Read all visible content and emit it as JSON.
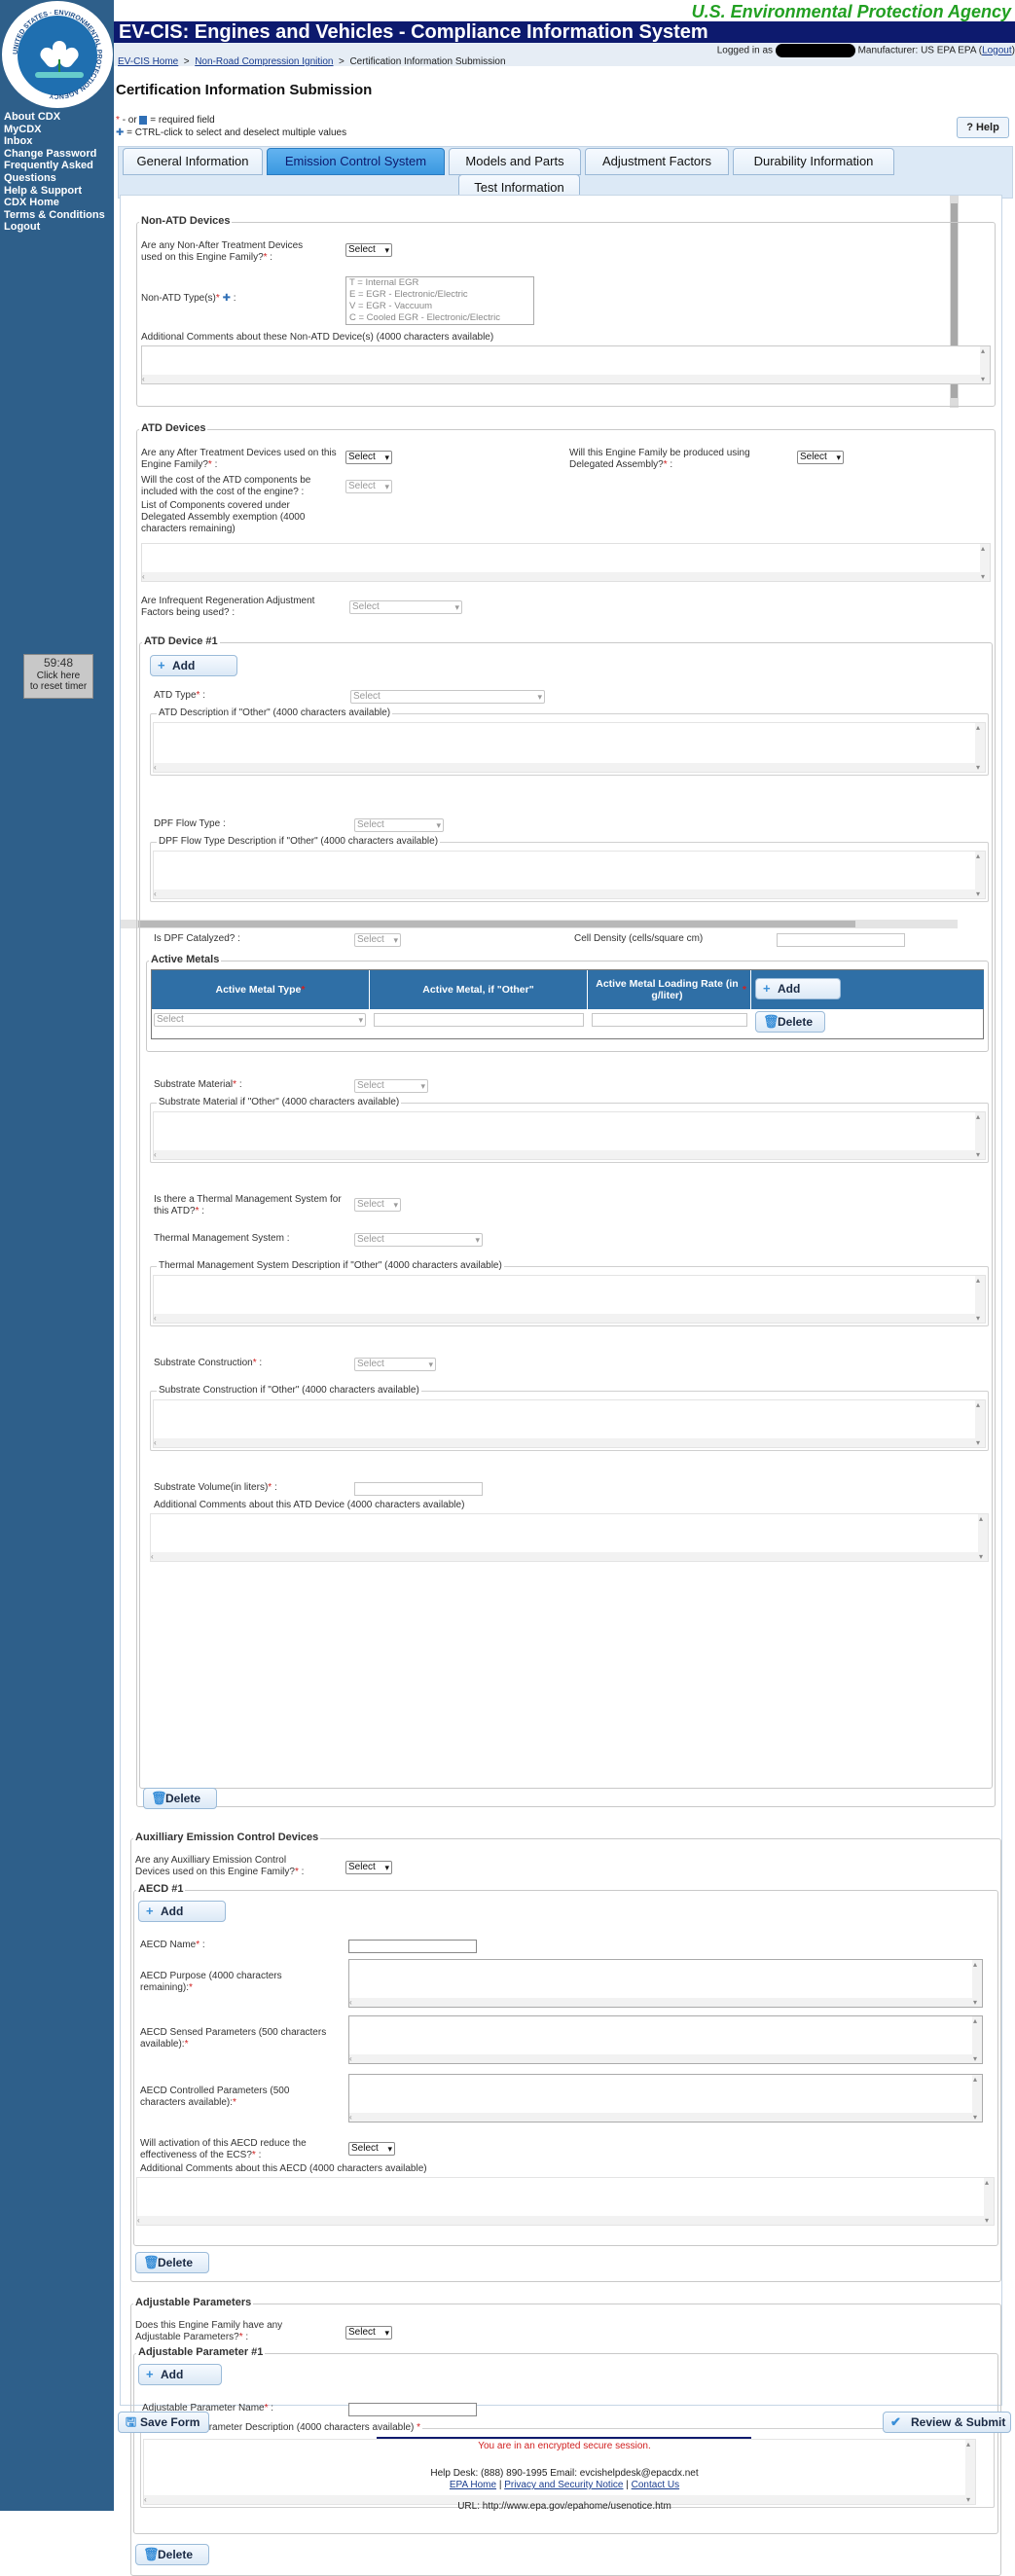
{
  "header": {
    "agency": "U.S. Environmental Protection Agency",
    "app_title": "EV-CIS: Engines and Vehicles - Compliance Information System",
    "breadcrumb": [
      "EV-CIS Home",
      "Non-Road Compression Ignition",
      "Certification Information Submission"
    ],
    "login_prefix": "Logged in as",
    "manufacturer": "Manufacturer: US EPA EPA",
    "logout": "Logout"
  },
  "sidebar": {
    "nav": [
      "About CDX",
      "MyCDX",
      "Inbox",
      "Change Password",
      "Frequently Asked Questions",
      "Help & Support",
      "CDX Home",
      "Terms & Conditions",
      "Logout"
    ],
    "timer": {
      "time": "59:48",
      "line1": "Click here",
      "line2": "to reset timer"
    }
  },
  "page": {
    "title": "Certification Information Submission",
    "legend_required": "= required field",
    "legend_required_prefix": "- or",
    "legend_multi": "= CTRL-click to select and deselect multiple values",
    "help": "? Help"
  },
  "tabs": [
    "General Information",
    "Emission Control System",
    "Models and Parts",
    "Adjustment Factors",
    "Durability Information",
    "Test Information"
  ],
  "active_tab": "Emission Control System",
  "non_atd": {
    "title": "Non-ATD Devices",
    "q_used": "Are any Non-After Treatment Devices used on this Engine Family?",
    "q_used_value": "Select",
    "types_label": "Non-ATD Type(s)",
    "types_options": [
      "T = Internal EGR",
      "E = EGR - Electronic/Electric",
      "V = EGR - Vaccuum",
      "C = Cooled EGR - Electronic/Electric"
    ],
    "comments_label": "Additional Comments about these Non-ATD Device(s) (4000 characters available)"
  },
  "atd": {
    "title": "ATD Devices",
    "q_used": "Are any After Treatment Devices used on this Engine Family?",
    "q_used_value": "Select",
    "q_delegated": "Will this Engine Family be produced using Delegated Assembly?",
    "q_delegated_value": "Select",
    "q_cost": "Will the cost of the ATD components be included with the cost of the engine?",
    "q_cost_value": "Select",
    "components_label": "List of Components covered under Delegated Assembly exemption (4000 characters remaining)",
    "q_regen": "Are Infrequent Regeneration Adjustment Factors being used?",
    "q_regen_value": "Select",
    "device_title": "ATD Device #1",
    "add": "Add",
    "type_label": "ATD Type",
    "type_value": "Select",
    "desc_other": "ATD Description if \"Other\" (4000 characters available)",
    "dpf_flow_label": "DPF Flow Type",
    "dpf_flow_value": "Select",
    "dpf_flow_desc": "DPF Flow Type Description if \"Other\" (4000 characters available)",
    "dpf_cat_label": "Is DPF Catalyzed?",
    "dpf_cat_value": "Select",
    "cell_density": "Cell Density (cells/square cm)",
    "active_metals_title": "Active Metals",
    "metal_headers": [
      "Active Metal Type",
      "Active Metal, if \"Other\"",
      "Active Metal Loading Rate (in g/liter)"
    ],
    "metal_type_value": "Select",
    "metal_add": "Add",
    "metal_delete": "Delete",
    "substrate_mat_label": "Substrate Material",
    "substrate_mat_value": "Select",
    "substrate_mat_other": "Substrate Material if \"Other\" (4000 characters available)",
    "thermal_q": "Is there a Thermal Management System for this ATD?",
    "thermal_q_value": "Select",
    "thermal_sys_label": "Thermal Management System",
    "thermal_sys_value": "Select",
    "thermal_desc": "Thermal Management System Description if \"Other\" (4000 characters available)",
    "substrate_con_label": "Substrate Construction",
    "substrate_con_value": "Select",
    "substrate_con_other": "Substrate Construction if \"Other\" (4000 characters available)",
    "substrate_vol_label": "Substrate Volume(in liters)",
    "device_comments": "Additional Comments about this ATD Device (4000 characters available)",
    "delete": "Delete"
  },
  "aecd": {
    "title": "Auxilliary Emission Control Devices",
    "q_used": "Are any Auxilliary Emission Control Devices used on this Engine Family?",
    "q_used_value": "Select",
    "item_title": "AECD #1",
    "add": "Add",
    "name_label": "AECD Name",
    "purpose_label": "AECD Purpose (4000 characters remaining):",
    "sensed_label": "AECD Sensed Parameters (500 characters available):",
    "controlled_label": "AECD Controlled Parameters (500 characters available):",
    "reduce_q": "Will activation of this AECD reduce the effectiveness of the ECS?",
    "reduce_value": "Select",
    "comments_label": "Additional Comments about this AECD (4000 characters available)",
    "delete": "Delete"
  },
  "adjustable": {
    "title": "Adjustable Parameters",
    "q_has": "Does this Engine Family have any Adjustable Parameters?",
    "q_has_value": "Select",
    "item_title": "Adjustable Parameter #1",
    "add": "Add",
    "name_label": "Adjustable Parameter Name",
    "desc_label": "Adjustable Parameter Description (4000  characters available)",
    "delete": "Delete"
  },
  "actions": {
    "save": "Save Form",
    "submit": "Review & Submit"
  },
  "footer": {
    "secure": "You are in an encrypted secure session.",
    "help": "Help Desk: (888) 890-1995   Email: evcishelpdesk@epacdx.net",
    "links": [
      "EPA Home",
      "Privacy and Security Notice",
      "Contact Us"
    ],
    "url": "URL: http://www.epa.gov/epahome/usenotice.htm"
  },
  "colors": {
    "title_bar": "#0d1a6e",
    "sidebar": "#2e5f8a",
    "agency": "#22a022",
    "active_tab": "#3a98e0",
    "required": "#d02020"
  }
}
